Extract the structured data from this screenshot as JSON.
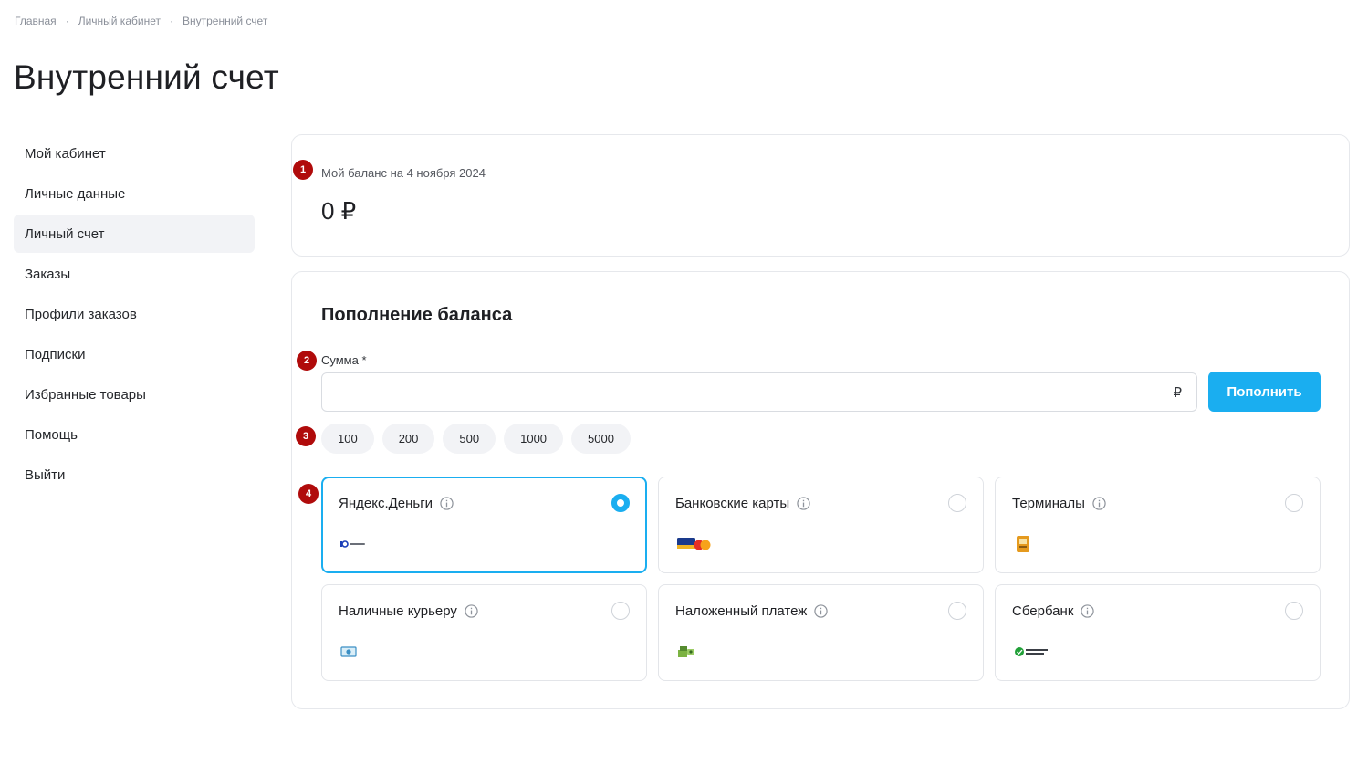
{
  "breadcrumb": [
    "Главная",
    "Личный кабинет",
    "Внутренний счет"
  ],
  "page_title": "Внутренний счет",
  "sidebar": {
    "items": [
      {
        "label": "Мой кабинет"
      },
      {
        "label": "Личные данные"
      },
      {
        "label": "Личный счет",
        "active": true
      },
      {
        "label": "Заказы"
      },
      {
        "label": "Профили заказов"
      },
      {
        "label": "Подписки"
      },
      {
        "label": "Избранные товары"
      },
      {
        "label": "Помощь"
      },
      {
        "label": "Выйти"
      }
    ]
  },
  "balance": {
    "step": "1",
    "label": "Мой баланс на 4 ноября 2024",
    "value": "0 ₽"
  },
  "topup": {
    "title": "Пополнение баланса",
    "amount_step": "2",
    "amount_label": "Сумма *",
    "amount_value": "",
    "currency": "₽",
    "button_label": "Пополнить",
    "quick_step": "3",
    "quick_amounts": [
      "100",
      "200",
      "500",
      "1000",
      "5000"
    ],
    "methods_step": "4",
    "methods": [
      {
        "name": "Яндекс.Деньги",
        "logo": "yookassa-logo",
        "selected": true
      },
      {
        "name": "Банковские карты",
        "logo": "visa-mastercard-logo",
        "selected": false
      },
      {
        "name": "Терминалы",
        "logo": "terminal-logo",
        "selected": false
      },
      {
        "name": "Наличные курьеру",
        "logo": "cash-logo",
        "selected": false
      },
      {
        "name": "Наложенный платеж",
        "logo": "cod-logo",
        "selected": false
      },
      {
        "name": "Сбербанк",
        "logo": "sberbank-logo",
        "selected": false
      }
    ]
  },
  "colors": {
    "accent": "#1aaef0",
    "step_badge": "#b00b0b",
    "active_bg": "#f2f3f6"
  }
}
